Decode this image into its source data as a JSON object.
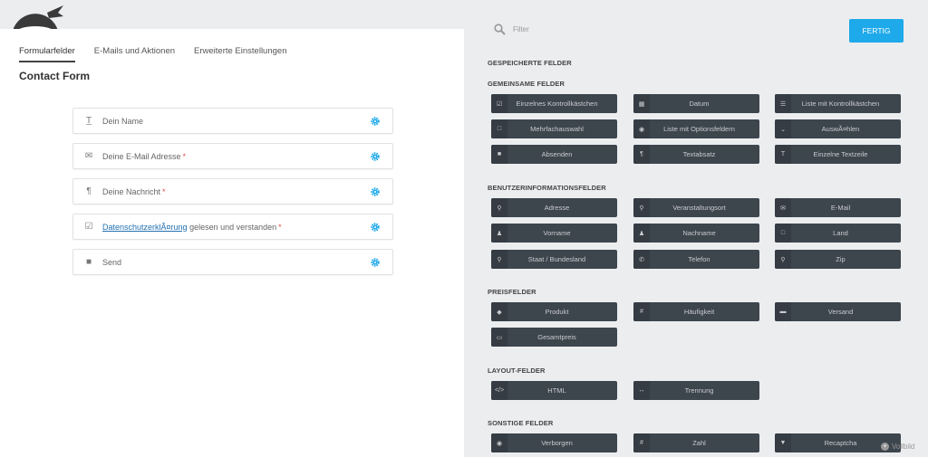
{
  "tabs": [
    {
      "label": "Formularfelder",
      "active": true
    },
    {
      "label": "E-Mails und Aktionen",
      "active": false
    },
    {
      "label": "Erweiterte Einstellungen",
      "active": false
    }
  ],
  "form_title": "Contact Form",
  "form_fields": [
    {
      "icon": "text-cursor-icon",
      "label": "Dein Name",
      "required": false
    },
    {
      "icon": "envelope-icon",
      "label": "Deine E-Mail Adresse",
      "required": true
    },
    {
      "icon": "paragraph-icon",
      "label": "Deine Nachricht",
      "required": true
    },
    {
      "icon": "checkbox-icon",
      "link_text": "DatenschutzerklÃ¤rung",
      "label": " gelesen und verstanden",
      "required": true
    },
    {
      "icon": "square-icon",
      "label": "Send",
      "required": false
    }
  ],
  "required_marker": "*",
  "search": {
    "placeholder": "Filter"
  },
  "done_button": "FERTIG",
  "sections": {
    "saved": "GESPEICHERTE FELDER",
    "common": "GEMEINSAME FELDER",
    "user_info": "BENUTZERINFORMATIONSFELDER",
    "pricing": "PREISFELDER",
    "layout": "LAYOUT-FELDER",
    "misc": "SONSTIGE FELDER"
  },
  "common_fields": [
    {
      "icon": "checkbox-icon",
      "label": "Einzelnes Kontrollkästchen"
    },
    {
      "icon": "calendar-icon",
      "label": "Datum"
    },
    {
      "icon": "list-icon",
      "label": "Liste mit Kontrollkästchen"
    },
    {
      "icon": "square-outline-icon",
      "label": "Mehrfachauswahl"
    },
    {
      "icon": "radio-icon",
      "label": "Liste mit Optionsfeldern"
    },
    {
      "icon": "chevron-down-icon",
      "label": "AuswÃ¤hlen"
    },
    {
      "icon": "square-icon",
      "label": "Absenden"
    },
    {
      "icon": "paragraph-icon",
      "label": "Textabsatz"
    },
    {
      "icon": "text-cursor-icon",
      "label": "Einzelne Textzeile"
    }
  ],
  "user_info_fields": [
    {
      "icon": "map-marker-icon",
      "label": "Adresse"
    },
    {
      "icon": "map-marker-icon",
      "label": "Veranstaltungsort"
    },
    {
      "icon": "envelope-icon",
      "label": "E-Mail"
    },
    {
      "icon": "user-icon",
      "label": "Vorname"
    },
    {
      "icon": "user-icon",
      "label": "Nachname"
    },
    {
      "icon": "square-outline-icon",
      "label": "Land"
    },
    {
      "icon": "map-marker-icon",
      "label": "Staat / Bundesland"
    },
    {
      "icon": "phone-icon",
      "label": "Telefon"
    },
    {
      "icon": "map-marker-icon",
      "label": "Zip"
    }
  ],
  "pricing_fields": [
    {
      "icon": "tag-icon",
      "label": "Produkt"
    },
    {
      "icon": "hash-icon",
      "label": "Häufigkeit"
    },
    {
      "icon": "truck-icon",
      "label": "Versand"
    },
    {
      "icon": "money-icon",
      "label": "Gesamtpreis"
    }
  ],
  "layout_fields": [
    {
      "icon": "code-icon",
      "label": "HTML"
    },
    {
      "icon": "divider-icon",
      "label": "Trennung"
    }
  ],
  "misc_fields": [
    {
      "icon": "eye-slash-icon",
      "label": "Verborgen"
    },
    {
      "icon": "hash-icon",
      "label": "Zahl"
    },
    {
      "icon": "filter-icon",
      "label": "Recaptcha"
    }
  ],
  "fullscreen_label": "Vollbild",
  "colors": {
    "accent": "#1ea9ea",
    "field_button_bg": "#3d454d",
    "required": "#d9534f",
    "link": "#2271b1"
  }
}
